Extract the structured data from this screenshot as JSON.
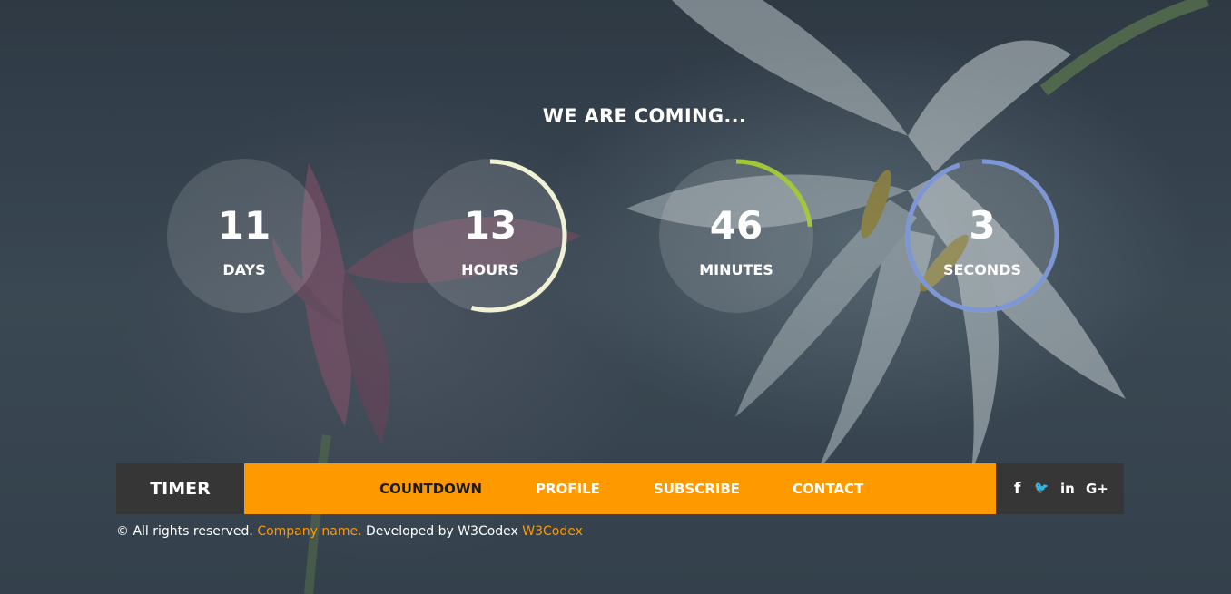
{
  "heading": "WE ARE COMING...",
  "timers": [
    {
      "value": "11",
      "label": "DAYS",
      "progress": 0,
      "ring_color": ""
    },
    {
      "value": "13",
      "label": "HOURS",
      "progress": 0.54,
      "ring_color": "#f1f2d4"
    },
    {
      "value": "46",
      "label": "MINUTES",
      "progress": 0.23,
      "ring_color": "#a4c639"
    },
    {
      "value": "3",
      "label": "SECONDS",
      "progress": 0.95,
      "ring_color": "#7d97d6"
    }
  ],
  "navbar": {
    "brand": "TIMER",
    "items": [
      {
        "label": "COUNTDOWN",
        "active": true
      },
      {
        "label": "PROFILE",
        "active": false
      },
      {
        "label": "SUBSCRIBE",
        "active": false
      },
      {
        "label": "CONTACT",
        "active": false
      }
    ],
    "social": [
      {
        "icon": "facebook-icon",
        "glyph": "f"
      },
      {
        "icon": "twitter-icon",
        "glyph": "🐦"
      },
      {
        "icon": "linkedin-icon",
        "glyph": "in"
      },
      {
        "icon": "google-plus-icon",
        "glyph": "G+"
      }
    ]
  },
  "footer": {
    "copyright_symbol": "©",
    "text_before": " All rights reserved. ",
    "company_link": "Company name.",
    "text_middle": " Developed by W3Codex ",
    "developer_link": "W3Codex"
  },
  "colors": {
    "accent": "#ff9900",
    "dark_bar": "#363636",
    "text": "#ffffff"
  }
}
